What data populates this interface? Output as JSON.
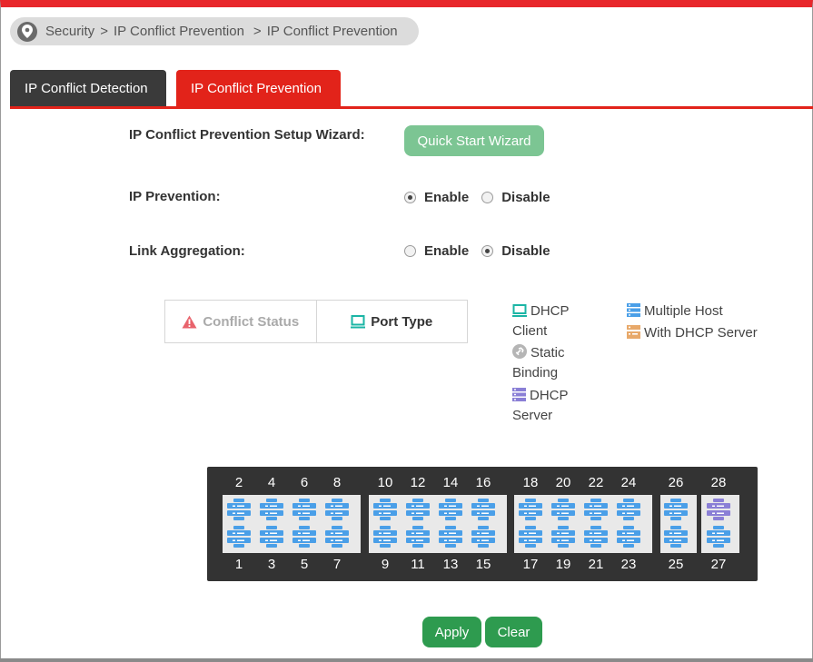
{
  "breadcrumb": {
    "items": [
      "Security",
      "IP Conflict Prevention",
      "IP Conflict Prevention"
    ],
    "separator": ">"
  },
  "tabs": [
    {
      "label": "IP Conflict Detection",
      "active": false
    },
    {
      "label": "IP Conflict Prevention",
      "active": true
    }
  ],
  "form": {
    "wizard_label": "IP Conflict Prevention Setup Wizard:",
    "wizard_button": "Quick Start Wizard",
    "ip_prevention": {
      "label": "IP Prevention:",
      "enable": "Enable",
      "disable": "Disable",
      "selected": "Enable"
    },
    "link_aggregation": {
      "label": "Link Aggregation:",
      "enable": "Enable",
      "disable": "Disable",
      "selected": "Disable"
    }
  },
  "views": {
    "conflict_status": "Conflict Status",
    "port_type": "Port Type"
  },
  "legend": {
    "dhcp_client_1": "DHCP",
    "dhcp_client_2": "Client",
    "static_1": "Static",
    "static_2": "Binding",
    "dhcp_server_1": "DHCP",
    "dhcp_server_2": "Server",
    "multiple_host": "Multiple Host",
    "with_dhcp_server": "With DHCP Server"
  },
  "colors": {
    "accent": "#e2231a",
    "port_multiple_host": "#4a9fe8",
    "port_dhcp_server": "#8a7fd6",
    "dhcp_client": "#1bb5a5",
    "static_binding": "#b5b5b5",
    "with_dhcp_server": "#e8a96a"
  },
  "ports": {
    "top": [
      "2",
      "4",
      "6",
      "8",
      "10",
      "12",
      "14",
      "16",
      "18",
      "20",
      "22",
      "24",
      "26",
      "28"
    ],
    "bottom": [
      "1",
      "3",
      "5",
      "7",
      "9",
      "11",
      "13",
      "15",
      "17",
      "19",
      "21",
      "23",
      "25",
      "27"
    ],
    "dhcp_server_port": "28"
  },
  "buttons": {
    "apply": "Apply",
    "clear": "Clear"
  }
}
